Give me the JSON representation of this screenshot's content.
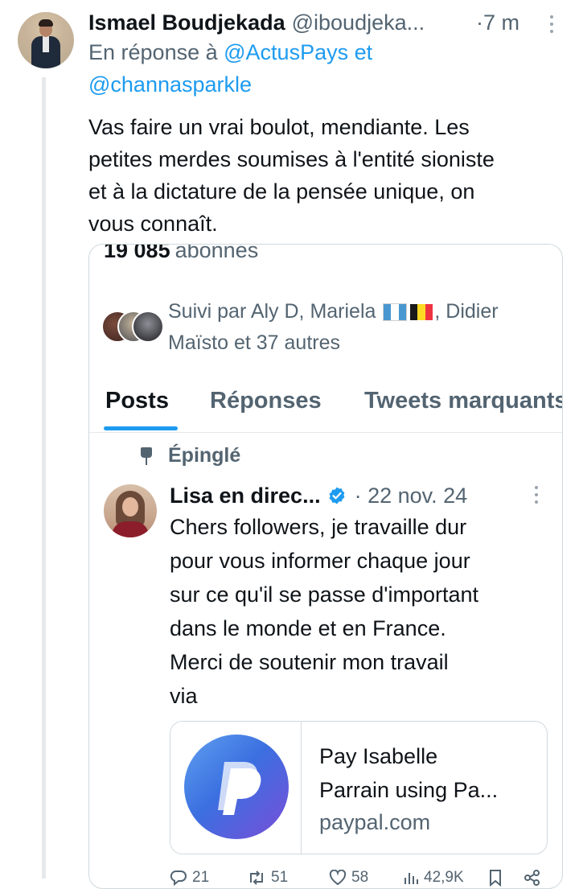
{
  "reply_tweet": {
    "author_name": "Ismael Boudjekada",
    "author_handle": "@iboudjeka...",
    "time_dot": "·",
    "time": "7 m",
    "reply_prefix": "En réponse à",
    "reply_to_1": "@ActusPays",
    "reply_conjunction": "et",
    "reply_to_2": "@channasparkle",
    "text_lines": [
      "Vas faire un vrai boulot, mendiante. Les",
      "petites merdes soumises à l'entité sioniste",
      "et à la dictature de la pensée unique, on",
      "vous connaît."
    ]
  },
  "profile_card": {
    "followers_count": "19 085",
    "followers_label": "abonnés",
    "followed_by_prefix": "Suivi par Aly D, Mariela",
    "followed_by_line2_prefix": ", Didier",
    "followed_by_line2": "Maïsto et 37 autres",
    "tabs": [
      "Posts",
      "Réponses",
      "Tweets marquants"
    ],
    "active_tab": "Posts"
  },
  "pinned_tweet": {
    "pinned_label": "Épinglé",
    "author_name": "Lisa en direc...",
    "date": "· 22 nov. 24",
    "text_lines": [
      "Chers followers, je travaille dur",
      "pour vous informer chaque jour",
      "sur ce qu'il se passe d'important",
      "dans le monde et en France.",
      "Merci de soutenir mon travail",
      "via"
    ],
    "link_card": {
      "title_lines": [
        "Pay Isabelle",
        "Parrain using Pa..."
      ],
      "domain": "paypal.com"
    },
    "stats": {
      "replies": "21",
      "retweets": "51",
      "likes": "58",
      "views": "42,9K"
    }
  },
  "colors": {
    "accent": "#1d9bf0",
    "text_primary": "#0f1419",
    "text_secondary": "#536471",
    "border": "#cfd9de"
  },
  "icons": [
    "more-dots-icon",
    "pin-icon",
    "verified-badge-icon",
    "paypal-logo-icon",
    "reply-icon",
    "retweet-icon",
    "like-icon",
    "views-icon",
    "bookmark-icon",
    "share-icon"
  ]
}
